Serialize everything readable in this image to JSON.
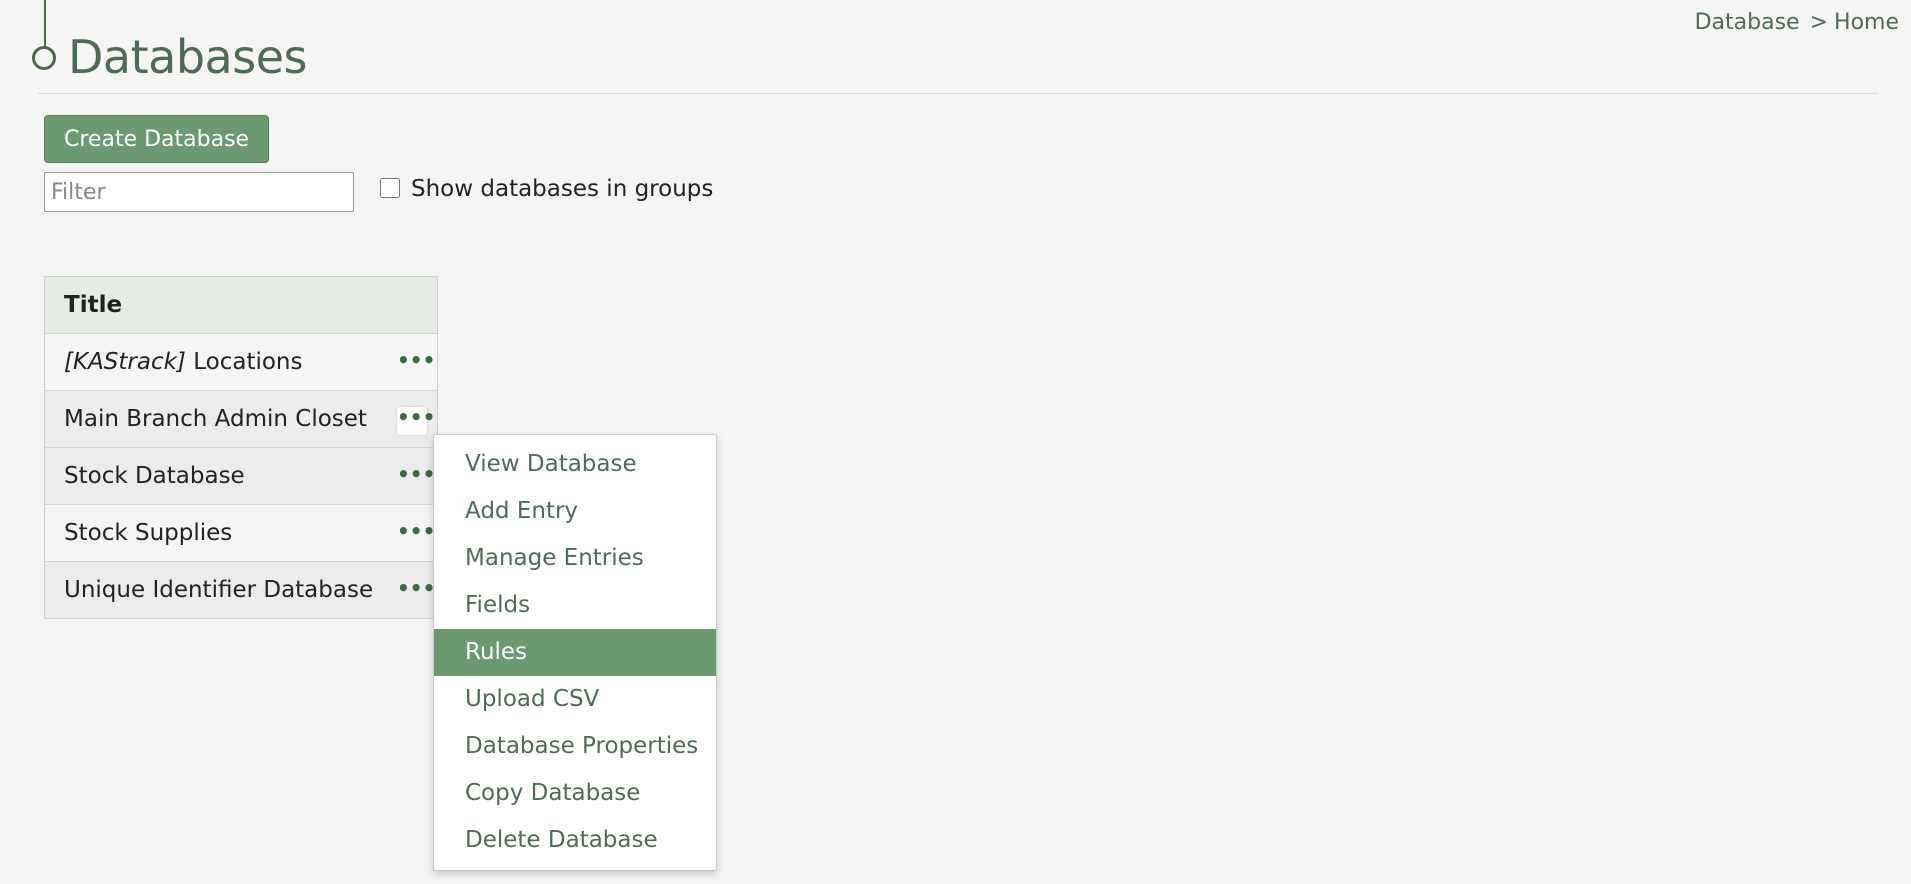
{
  "breadcrumb": {
    "parent": "Database",
    "separator": ">",
    "current": "Home"
  },
  "page_title": "Databases",
  "create_button_label": "Create Database",
  "filter": {
    "placeholder": "Filter",
    "value": ""
  },
  "group_toggle": {
    "label": "Show databases in groups",
    "checked": false
  },
  "table": {
    "header": "Title",
    "rows": [
      {
        "prefix": "[KAStrack]",
        "name": "Locations"
      },
      {
        "prefix": "",
        "name": "Main Branch Admin Closet"
      },
      {
        "prefix": "",
        "name": "Stock Database"
      },
      {
        "prefix": "",
        "name": "Stock Supplies"
      },
      {
        "prefix": "",
        "name": "Unique Identifier Database"
      }
    ],
    "action_glyph": "•••"
  },
  "context_menu": {
    "items": [
      "View Database",
      "Add Entry",
      "Manage Entries",
      "Fields",
      "Rules",
      "Upload CSV",
      "Database Properties",
      "Copy Database",
      "Delete Database"
    ],
    "selected": "Rules"
  },
  "colors": {
    "accent": "#6b9970",
    "title_text": "#4f6b58",
    "menu_text": "#4f6b58"
  }
}
